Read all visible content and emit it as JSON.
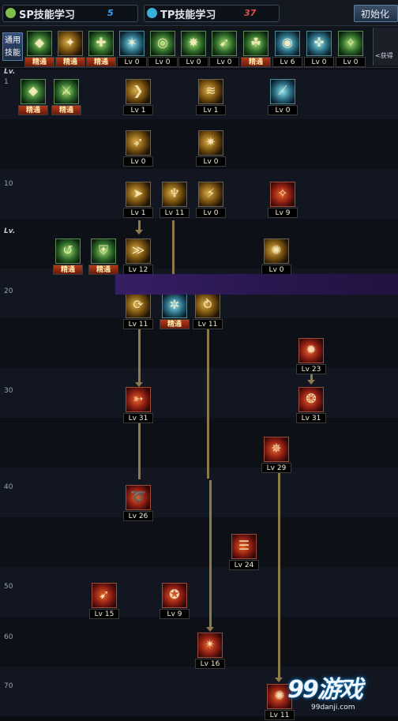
{
  "top_bar": {
    "sp": {
      "title": "SP技能学习",
      "value": "5",
      "value_color": "#3ba7ff"
    },
    "tp": {
      "title": "TP技能学习",
      "value": "37",
      "value_color": "#e05050"
    },
    "reset_label": "初始化"
  },
  "common_skills": {
    "tab_label": "通用技能",
    "more_label": "<获得",
    "items": [
      {
        "top": "",
        "bottom": "精通",
        "style": "green",
        "glyph": "◆"
      },
      {
        "top": "",
        "bottom": "精通",
        "style": "gold",
        "glyph": "✦"
      },
      {
        "top": "",
        "bottom": "精通",
        "style": "green",
        "glyph": "✚"
      },
      {
        "top": "",
        "bottom": "Lv 0",
        "style": "teal",
        "glyph": "✶"
      },
      {
        "top": "",
        "bottom": "Lv 0",
        "style": "green",
        "glyph": "◎"
      },
      {
        "top": "",
        "bottom": "Lv 0",
        "style": "green",
        "glyph": "✸"
      },
      {
        "top": "",
        "bottom": "Lv 0",
        "style": "green",
        "glyph": "➹"
      },
      {
        "top": "",
        "bottom": "精通",
        "style": "green",
        "glyph": "☘"
      },
      {
        "top": "",
        "bottom": "Lv 6",
        "style": "teal",
        "glyph": "◉"
      },
      {
        "top": "",
        "bottom": "Lv 0",
        "style": "teal",
        "glyph": "✜"
      },
      {
        "top": "",
        "bottom": "Lv 0",
        "style": "green",
        "glyph": "✧"
      }
    ]
  },
  "level_marks": [
    "1",
    "10",
    "20",
    "30",
    "40",
    "50",
    "60",
    "70"
  ],
  "section_marks": [
    "Lv.",
    "Lv."
  ],
  "skills": [
    {
      "id": "s1",
      "bottom": "精通",
      "style": "green",
      "glyph": "◆"
    },
    {
      "id": "s2",
      "bottom": "精通",
      "style": "green",
      "glyph": "⚔"
    },
    {
      "id": "s3",
      "bottom": "Lv 1",
      "style": "gold",
      "glyph": "❯"
    },
    {
      "id": "s4",
      "bottom": "Lv 1",
      "style": "gold",
      "glyph": "≋"
    },
    {
      "id": "s5",
      "bottom": "Lv 0",
      "style": "teal",
      "glyph": "⟋"
    },
    {
      "id": "s6",
      "bottom": "Lv 0",
      "style": "gold",
      "glyph": "➶"
    },
    {
      "id": "s7",
      "bottom": "Lv 0",
      "style": "gold",
      "glyph": "✷"
    },
    {
      "id": "s8",
      "bottom": "Lv 1",
      "style": "gold",
      "glyph": "➤"
    },
    {
      "id": "s9",
      "bottom": "Lv 11",
      "style": "gold",
      "glyph": "♆"
    },
    {
      "id": "s10",
      "bottom": "Lv 0",
      "style": "gold",
      "glyph": "⚡"
    },
    {
      "id": "s11",
      "bottom": "Lv 9",
      "style": "red",
      "glyph": "✧"
    },
    {
      "id": "s12",
      "bottom": "精通",
      "style": "green",
      "glyph": "↺"
    },
    {
      "id": "s13",
      "bottom": "精通",
      "style": "green",
      "glyph": "⛨"
    },
    {
      "id": "s14",
      "bottom": "Lv 12",
      "style": "gold",
      "glyph": "≫"
    },
    {
      "id": "s15",
      "bottom": "Lv 0",
      "style": "gold",
      "glyph": "✺"
    },
    {
      "id": "s16",
      "bottom": "Lv 11",
      "style": "gold",
      "glyph": "⟳"
    },
    {
      "id": "s17",
      "bottom": "精通",
      "style": "teal",
      "glyph": "✲"
    },
    {
      "id": "s18",
      "bottom": "Lv 11",
      "style": "gold",
      "glyph": "⥁"
    },
    {
      "id": "s19",
      "bottom": "Lv 23",
      "style": "red",
      "glyph": "✹"
    },
    {
      "id": "s20",
      "bottom": "Lv 31",
      "style": "red",
      "glyph": "➳"
    },
    {
      "id": "s21",
      "bottom": "Lv 31",
      "style": "red",
      "glyph": "❂"
    },
    {
      "id": "s22",
      "bottom": "Lv 29",
      "style": "red",
      "glyph": "✵"
    },
    {
      "id": "s23",
      "bottom": "Lv 26",
      "style": "red",
      "glyph": "➰"
    },
    {
      "id": "s24",
      "bottom": "Lv 24",
      "style": "red",
      "glyph": "☰"
    },
    {
      "id": "s25",
      "bottom": "Lv 15",
      "style": "red",
      "glyph": "➹"
    },
    {
      "id": "s26",
      "bottom": "Lv 9",
      "style": "red",
      "glyph": "✪"
    },
    {
      "id": "s27",
      "bottom": "Lv 16",
      "style": "red",
      "glyph": "✴"
    },
    {
      "id": "s28",
      "bottom": "Lv 11",
      "style": "red",
      "glyph": "✺"
    }
  ],
  "watermark": {
    "logo": "99游戏",
    "url": "99danji.com"
  }
}
